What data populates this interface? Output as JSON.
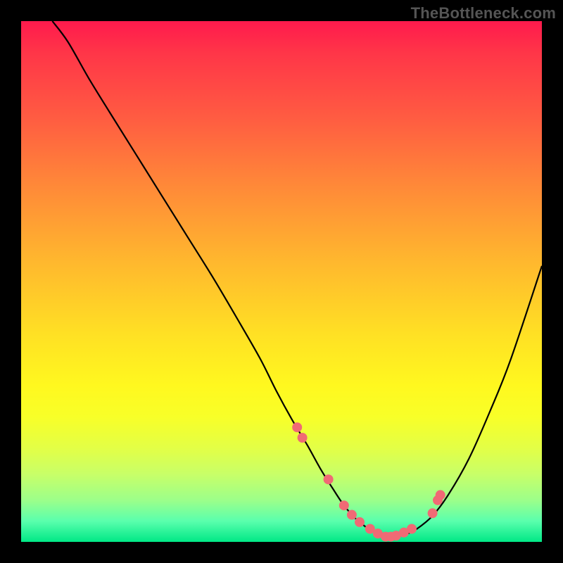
{
  "watermark": "TheBottleneck.com",
  "colors": {
    "curve": "#000000",
    "dot_fill": "#f06a75",
    "dot_stroke": "#f06a75"
  },
  "chart_data": {
    "type": "line",
    "title": "",
    "xlabel": "",
    "ylabel": "",
    "xlim": [
      0,
      100
    ],
    "ylim": [
      0,
      100
    ],
    "series": [
      {
        "name": "bottleneck-curve",
        "x": [
          6,
          9,
          13,
          17,
          22,
          27,
          32,
          37,
          42,
          46,
          49,
          52,
          55,
          57.5,
          60,
          62,
          64,
          66,
          68,
          70,
          72,
          74,
          76,
          79,
          82,
          86,
          90,
          94,
          100
        ],
        "y": [
          100,
          96,
          89,
          82.5,
          74.5,
          66.5,
          58.5,
          50.5,
          42,
          35,
          29,
          23.5,
          18.5,
          14,
          10,
          7,
          4.7,
          3,
          1.7,
          1,
          1,
          1.5,
          2.5,
          5,
          9,
          16,
          25,
          35,
          53
        ]
      }
    ],
    "dots": {
      "name": "highlight-dots",
      "x": [
        53,
        54,
        59,
        62,
        63.5,
        65,
        67,
        68.5,
        70,
        71,
        72,
        73.5,
        75,
        79,
        80,
        80.5
      ],
      "y": [
        22,
        20,
        12,
        7,
        5.2,
        3.8,
        2.5,
        1.6,
        1,
        1,
        1.2,
        1.8,
        2.5,
        5.5,
        8,
        9
      ]
    },
    "dot_radius_px": 6.5
  }
}
